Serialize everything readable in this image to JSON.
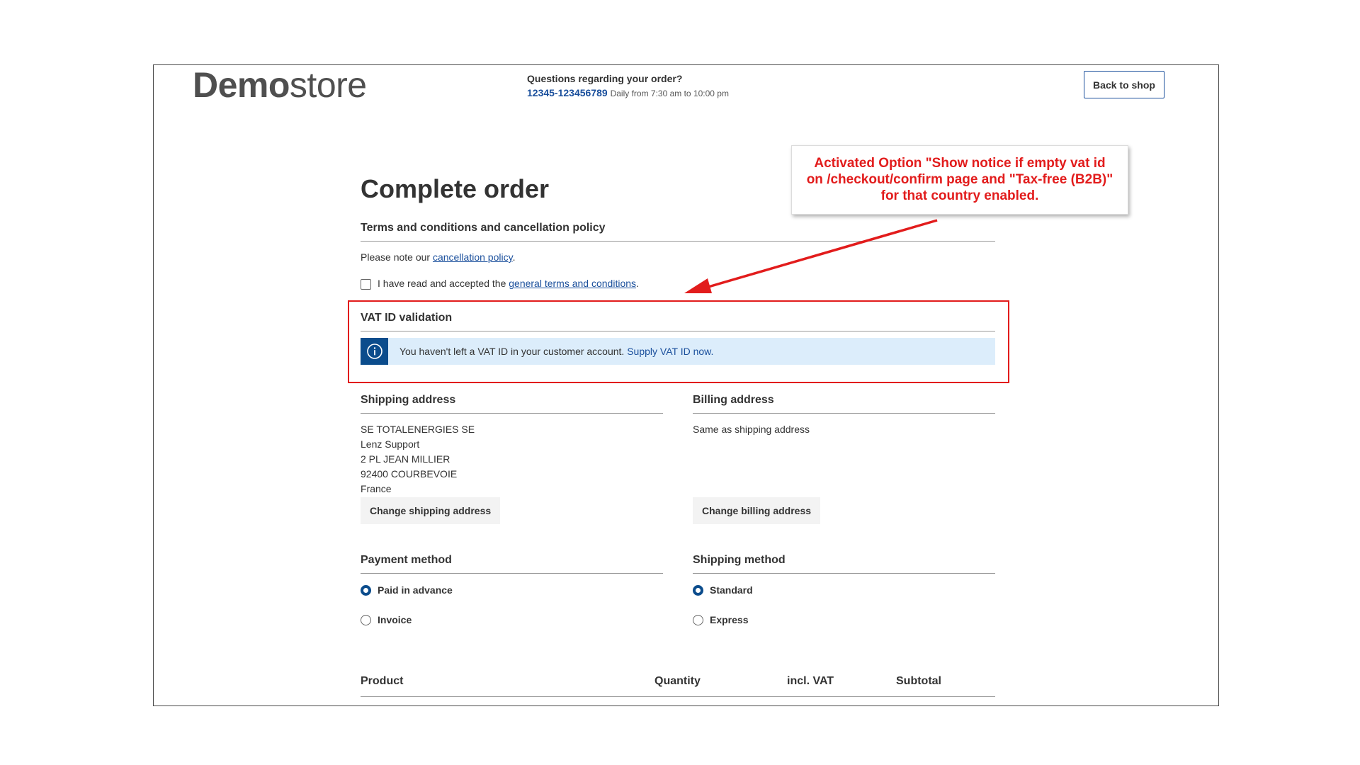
{
  "header": {
    "logo_bold": "Demo",
    "logo_light": "store",
    "support_question": "Questions regarding your order?",
    "support_phone": "12345-123456789",
    "support_hours": "Daily from 7:30 am to 10:00 pm",
    "back_button": "Back to shop"
  },
  "annotation": {
    "line1": "Activated Option \"Show notice if empty vat id",
    "line2": "on /checkout/confirm page and \"Tax-free (B2B)\"",
    "line3": "for that country enabled.",
    "color": "#e21c1c"
  },
  "page": {
    "title": "Complete order"
  },
  "terms": {
    "heading": "Terms and conditions and cancellation policy",
    "note_prefix": "Please note our ",
    "note_link": "cancellation policy",
    "note_suffix": ".",
    "checkbox_prefix": "I have read and accepted the ",
    "checkbox_link": "general terms and conditions",
    "checkbox_suffix": "."
  },
  "vat": {
    "heading": "VAT ID validation",
    "message": "You haven't left a VAT ID in your customer account. ",
    "message_link": "Supply VAT ID now.",
    "icon": "info-icon"
  },
  "shipping_address": {
    "heading": "Shipping address",
    "lines": [
      "SE TOTALENERGIES SE",
      "Lenz Support",
      "2 PL JEAN MILLIER",
      "92400 COURBEVOIE",
      "France"
    ],
    "button": "Change shipping address"
  },
  "billing_address": {
    "heading": "Billing address",
    "text": "Same as shipping address",
    "button": "Change billing address"
  },
  "payment": {
    "heading": "Payment method",
    "options": [
      {
        "label": "Paid in advance",
        "selected": true
      },
      {
        "label": "Invoice",
        "selected": false
      }
    ]
  },
  "shipping_method": {
    "heading": "Shipping method",
    "options": [
      {
        "label": "Standard",
        "selected": true
      },
      {
        "label": "Express",
        "selected": false
      }
    ]
  },
  "table": {
    "headers": [
      "Product",
      "Quantity",
      "incl. VAT",
      "Subtotal"
    ]
  },
  "colors": {
    "brand_blue": "#0b4c8c",
    "link_blue": "#1a4f9c",
    "alert_bg": "#dcedfb",
    "highlight_red": "#e21c1c"
  }
}
